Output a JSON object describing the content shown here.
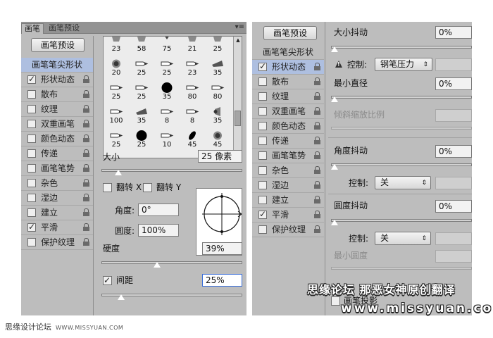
{
  "left_panel": {
    "tabs": [
      {
        "label": "画笔"
      },
      {
        "label": "画笔预设"
      }
    ],
    "menu_icon": "▾≡",
    "preset_button": "画笔预设",
    "sidebar_header": "画笔笔尖形状",
    "sidebar_items": [
      {
        "label": "形状动态",
        "checked": true,
        "mark": "✓"
      },
      {
        "label": "散布",
        "checked": false,
        "mark": ""
      },
      {
        "label": "纹理",
        "checked": false,
        "mark": ""
      },
      {
        "label": "双重画笔",
        "checked": false,
        "mark": ""
      },
      {
        "label": "颜色动态",
        "checked": false,
        "mark": ""
      },
      {
        "label": "传递",
        "checked": false,
        "mark": ""
      },
      {
        "label": "画笔笔势",
        "checked": false,
        "mark": ""
      },
      {
        "label": "杂色",
        "checked": false,
        "mark": ""
      },
      {
        "label": "湿边",
        "checked": false,
        "mark": ""
      },
      {
        "label": "建立",
        "checked": false,
        "mark": ""
      },
      {
        "label": "平滑",
        "checked": true,
        "mark": "✓"
      },
      {
        "label": "保护纹理",
        "checked": false,
        "mark": ""
      }
    ],
    "brush_grid": {
      "rows": [
        [
          {
            "size": "23",
            "icon": "chalk-icon"
          },
          {
            "size": "58",
            "icon": "chalk-icon"
          },
          {
            "size": "75",
            "icon": "tip-icon"
          },
          {
            "size": "21",
            "icon": "chalk-icon"
          },
          {
            "size": "25",
            "icon": "chalk-icon"
          }
        ],
        [
          {
            "size": "20",
            "icon": "soft-round-icon"
          },
          {
            "size": "25",
            "icon": "pencil-tip-icon"
          },
          {
            "size": "25",
            "icon": "pencil-tip-icon"
          },
          {
            "size": "23",
            "icon": "pencil-tip-icon"
          },
          {
            "size": "35",
            "icon": "fan-tip-icon"
          }
        ],
        [
          {
            "size": "25",
            "icon": "pencil-tip-icon"
          },
          {
            "size": "25",
            "icon": "pencil-tip-icon"
          },
          {
            "size": "35",
            "icon": "hard-round-icon"
          },
          {
            "size": "80",
            "icon": "pencil-tip-icon"
          },
          {
            "size": "80",
            "icon": "pencil-tip-icon"
          }
        ],
        [
          {
            "size": "100",
            "icon": "pencil-tip-icon"
          },
          {
            "size": "35",
            "icon": "fan-tip-icon"
          },
          {
            "size": "8",
            "icon": "pencil-tip-icon"
          },
          {
            "size": "8",
            "icon": "pencil-tip-icon"
          },
          {
            "size": "35",
            "icon": "airbrush-icon"
          }
        ],
        [
          {
            "size": "25",
            "icon": "pencil-tip-icon"
          },
          {
            "size": "25",
            "icon": "hard-round-icon"
          },
          {
            "size": "10",
            "icon": "pencil-tip-icon"
          },
          {
            "size": "45",
            "icon": "ellipse-tip-icon"
          },
          {
            "size": "45",
            "icon": "soft-round-icon"
          }
        ]
      ]
    },
    "size_label": "大小",
    "size_value": "25 像素",
    "size_level": 0.1,
    "flip_x_label": "翻转 X",
    "flip_y_label": "翻转 Y",
    "angle_label": "角度:",
    "angle_value": "0°",
    "roundness_label": "圆度:",
    "roundness_value": "100%",
    "hardness_label": "硬度",
    "hardness_value": "39%",
    "hardness_level": 0.39,
    "spacing_label": "间距",
    "spacing_checked": true,
    "spacing_mark": "✓",
    "spacing_value": "25%",
    "spacing_level": 0.12
  },
  "right_panel": {
    "preset_button": "画笔预设",
    "sidebar_header": "画笔笔尖形状",
    "sidebar_items": [
      {
        "label": "形状动态",
        "checked": true,
        "selected": true,
        "mark": "✓"
      },
      {
        "label": "散布",
        "checked": false,
        "mark": ""
      },
      {
        "label": "纹理",
        "checked": false,
        "mark": ""
      },
      {
        "label": "双重画笔",
        "checked": false,
        "mark": ""
      },
      {
        "label": "颜色动态",
        "checked": false,
        "mark": ""
      },
      {
        "label": "传递",
        "checked": false,
        "mark": ""
      },
      {
        "label": "画笔笔势",
        "checked": false,
        "mark": ""
      },
      {
        "label": "杂色",
        "checked": false,
        "mark": ""
      },
      {
        "label": "湿边",
        "checked": false,
        "mark": ""
      },
      {
        "label": "建立",
        "checked": false,
        "mark": ""
      },
      {
        "label": "平滑",
        "checked": true,
        "mark": "✓"
      },
      {
        "label": "保护纹理",
        "checked": false,
        "mark": ""
      }
    ],
    "size_jitter_label": "大小抖动",
    "size_jitter_value": "0%",
    "size_jitter_level": 0,
    "warning_glyph": "!",
    "control_label": "控制:",
    "size_control_value": "钢笔压力",
    "min_diameter_label": "最小直径",
    "min_diameter_value": "0%",
    "min_diameter_level": 0,
    "tilt_scale_label": "倾斜缩放比例",
    "angle_jitter_label": "角度抖动",
    "angle_jitter_value": "0%",
    "angle_jitter_level": 0,
    "angle_control_label": "控制:",
    "angle_control_value": "关",
    "roundness_jitter_label": "圆度抖动",
    "roundness_jitter_value": "0%",
    "roundness_jitter_level": 0,
    "roundness_control_label": "控制:",
    "roundness_control_value": "关",
    "min_roundness_label": "最小圆度",
    "flip_projection_label": "画笔投影"
  },
  "watermark": {
    "line1": "思缘论坛 那恶女神原创翻译",
    "line2": "www.missyuan.com"
  },
  "footer": {
    "site_name": "思缘设计论坛",
    "site_url": "WWW.MISSYUAN.COM"
  }
}
